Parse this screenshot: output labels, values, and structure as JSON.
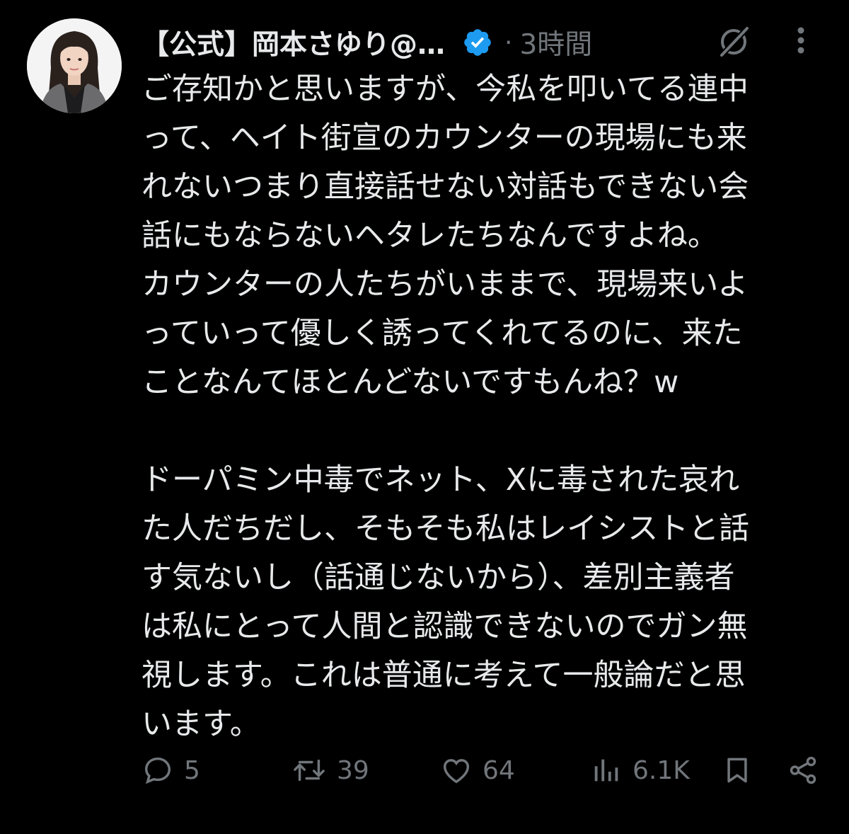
{
  "tweet": {
    "display_name": "【公式】岡本さゆり@…",
    "dot": "·",
    "time": "3時間",
    "verified": true,
    "avatar": "profile-photo",
    "body_lines_1": [
      "ご存知かと思いますが、今私を叩いてる連中",
      "って、ヘイト街宣のカウンターの現場にも来",
      "れないつまり直接話せない対話もできない会",
      "話にもならないヘタレたちなんですよね。",
      "カウンターの人たちがいままで、現場来いよ",
      "っていって優しく誘ってくれてるのに、来た",
      "ことなんてほとんどないですもんね？w"
    ],
    "body_lines_2": [
      "ドーパミン中毒でネット、Xに毒された哀れ",
      "た人だちだし、そもそも私はレイシストと話",
      "す気ないし（話通じないから）、差別主義者",
      "は私にとって人間と認識できないのでガン無",
      "視します。これは普通に考えて一般論だと思",
      "います。"
    ]
  },
  "actions": {
    "replies": "5",
    "reposts": "39",
    "likes": "64",
    "views": "6.1K"
  },
  "colors": {
    "background": "#000000",
    "text": "#e7e9ea",
    "muted": "#71767b",
    "verified": "#1d9bf0"
  }
}
